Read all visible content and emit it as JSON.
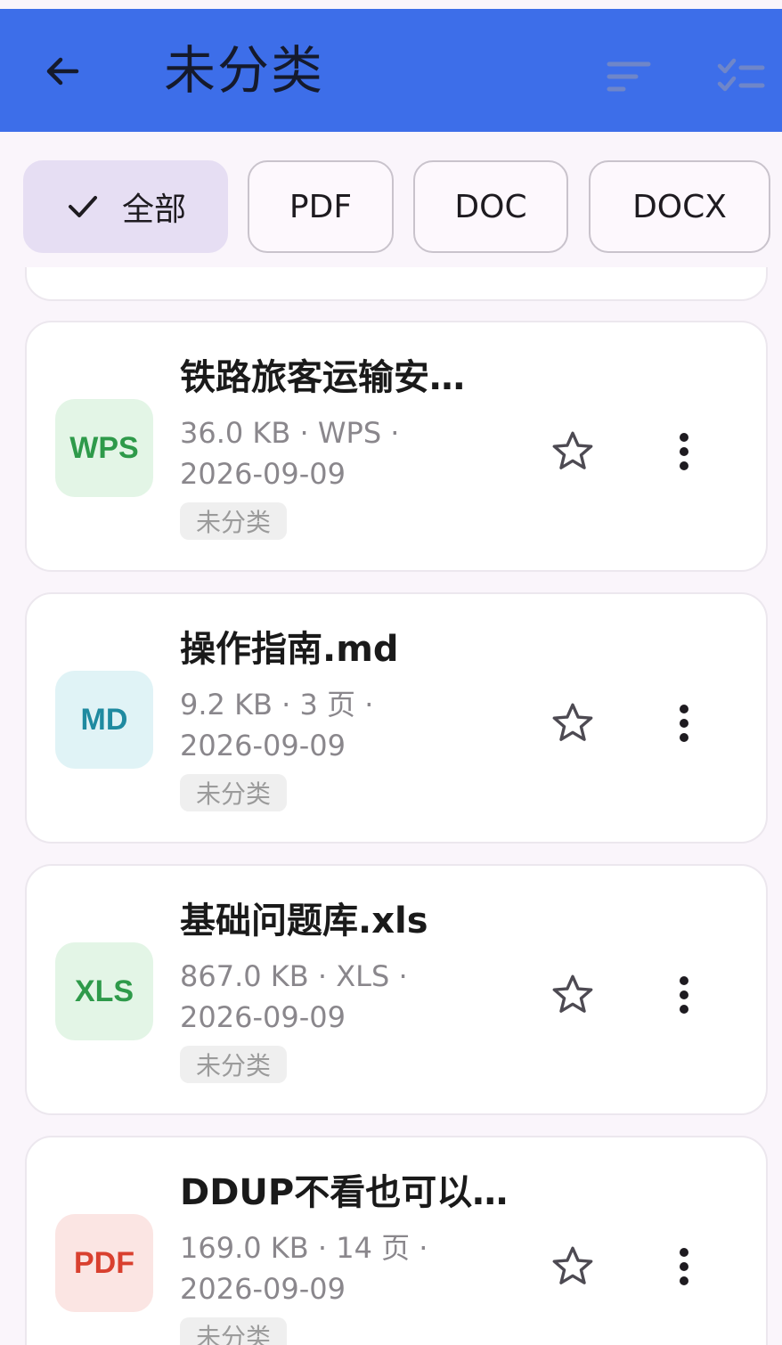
{
  "header": {
    "title": "未分类",
    "back_icon": "arrow-left-icon",
    "sort_icon": "sort-icon",
    "select_icon": "checklist-icon",
    "background": "#3d6ee9"
  },
  "filters": {
    "chips": [
      {
        "label": "全部",
        "selected": true
      },
      {
        "label": "PDF",
        "selected": false
      },
      {
        "label": "DOC",
        "selected": false
      },
      {
        "label": "DOCX",
        "selected": false
      }
    ]
  },
  "files": [
    {
      "badge": "WPS",
      "badge_color": "#2e9a4a",
      "badge_bg": "#e3f5e6",
      "name": "铁路旅客运输安…",
      "meta_line1": "36.0 KB · WPS ·",
      "meta_line2": "2026-09-09",
      "category": "未分类"
    },
    {
      "badge": "MD",
      "badge_color": "#1f8aa0",
      "badge_bg": "#e0f3f6",
      "name": "操作指南.md",
      "meta_line1": "9.2 KB · 3 页 ·",
      "meta_line2": "2026-09-09",
      "category": "未分类"
    },
    {
      "badge": "XLS",
      "badge_color": "#2e9a4a",
      "badge_bg": "#e3f5e6",
      "name": "基础问题库.xls",
      "meta_line1": "867.0 KB · XLS ·",
      "meta_line2": "2026-09-09",
      "category": "未分类"
    },
    {
      "badge": "PDF",
      "badge_color": "#d9402f",
      "badge_bg": "#fbe5e3",
      "name": "DDUP不看也可以…",
      "meta_line1": "169.0 KB · 14 页 ·",
      "meta_line2": "2026-09-09",
      "category": "未分类"
    }
  ]
}
